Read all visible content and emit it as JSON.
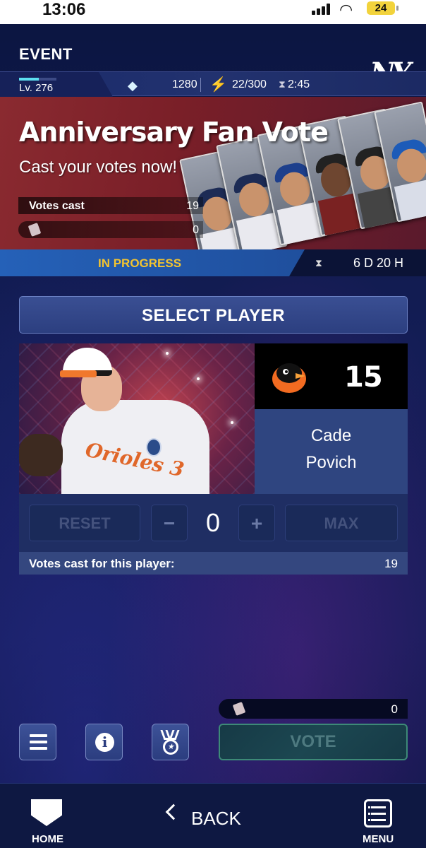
{
  "status_bar": {
    "time": "13:06",
    "battery": "24"
  },
  "header": {
    "section": "EVENT",
    "team_logo": "NY"
  },
  "stats": {
    "level": "Lv. 276",
    "gems": "1280",
    "energy": "22/300",
    "timer": "2:45"
  },
  "banner": {
    "title": "Anniversary Fan Vote",
    "subtitle": "Cast your votes now!",
    "votes_cast_label": "Votes cast",
    "votes_cast_value": "19",
    "tickets_value": "0"
  },
  "progress": {
    "status": "IN PROGRESS",
    "time_left": "6 D 20 H"
  },
  "select_player": {
    "label": "SELECT PLAYER"
  },
  "player": {
    "number": "15",
    "first_name": "Cade",
    "last_name": "Povich",
    "jersey_text": "Orioles 3"
  },
  "controls": {
    "reset": "RESET",
    "minus": "−",
    "count": "0",
    "plus": "+",
    "max": "MAX"
  },
  "votes_for_player": {
    "label": "Votes cast for this player:",
    "value": "19"
  },
  "vote_bar": {
    "tickets": "0",
    "vote_label": "VOTE"
  },
  "icons": [
    "menu-icon",
    "info-icon",
    "medal-icon",
    "home-icon",
    "back-icon",
    "menu-grid-icon"
  ],
  "bottom_nav": {
    "home": "HOME",
    "back": "BACK",
    "menu": "MENU"
  }
}
